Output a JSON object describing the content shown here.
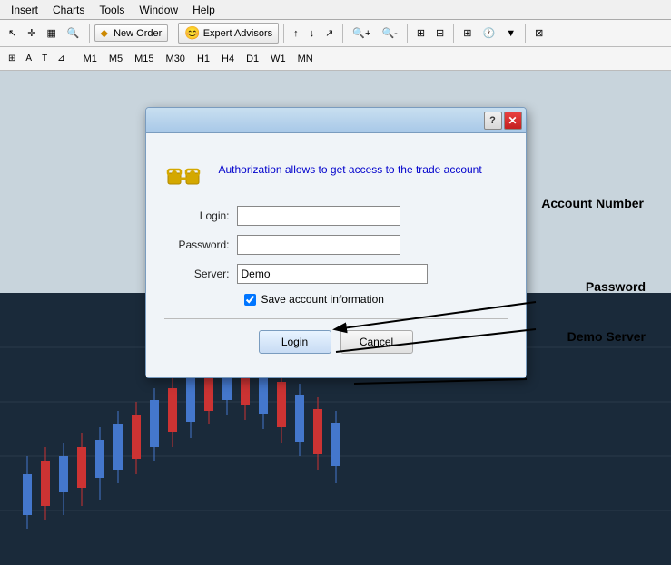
{
  "menubar": {
    "items": [
      "Insert",
      "Charts",
      "Tools",
      "Window",
      "Help"
    ]
  },
  "toolbar": {
    "new_order_label": "New Order",
    "expert_advisors_label": "Expert Advisors"
  },
  "timeframes": {
    "items": [
      "M1",
      "M5",
      "M15",
      "M30",
      "H1",
      "H4",
      "D1",
      "W1",
      "MN"
    ]
  },
  "dialog": {
    "message": "Authorization allows to get access to the trade account",
    "login_label": "Login:",
    "password_label": "Password:",
    "server_label": "Server:",
    "server_value": "Demo",
    "save_label": "Save account information",
    "login_btn": "Login",
    "cancel_btn": "Cancel",
    "help_btn": "?",
    "close_btn": "✕"
  },
  "annotations": {
    "account_number": "Account Number",
    "password": "Password",
    "demo_server": "Demo Server"
  }
}
